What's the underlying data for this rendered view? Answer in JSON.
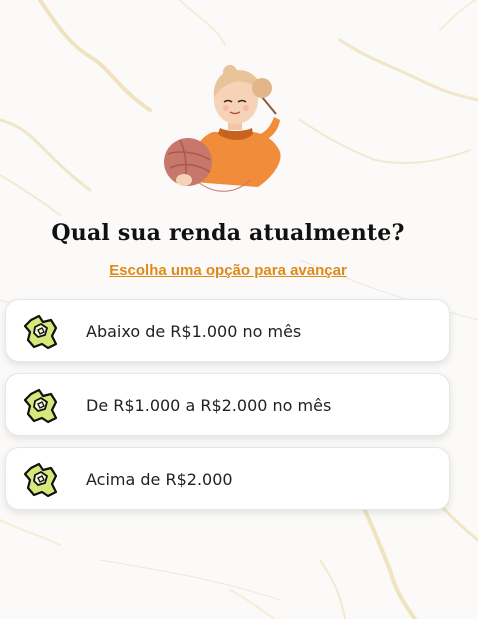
{
  "quiz": {
    "question": "Qual sua renda atualmente?",
    "subtitle": "Escolha uma opção para avançar",
    "illustration_icon": "knitting-woman-with-yarn-illustration",
    "colors": {
      "accent": "#dd8a1a",
      "icon_green": "#d6e87a",
      "icon_outline": "#111111"
    },
    "options": [
      {
        "icon": "turtle-icon",
        "label": "Abaixo de R$1.000 no mês"
      },
      {
        "icon": "turtle-icon",
        "label": "De R$1.000 a R$2.000 no mês"
      },
      {
        "icon": "turtle-icon",
        "label": "Acima de R$2.000"
      }
    ]
  }
}
